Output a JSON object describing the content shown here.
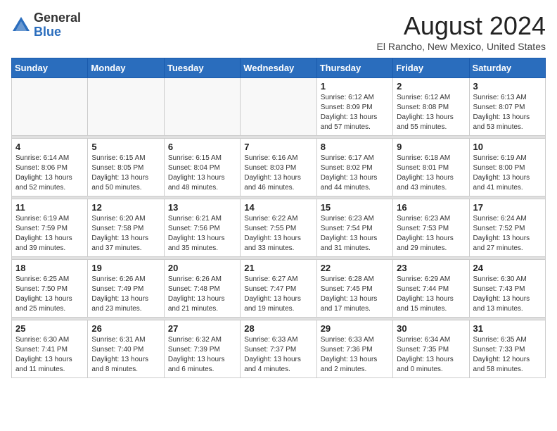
{
  "header": {
    "logo_general": "General",
    "logo_blue": "Blue",
    "month_year": "August 2024",
    "location": "El Rancho, New Mexico, United States"
  },
  "weekdays": [
    "Sunday",
    "Monday",
    "Tuesday",
    "Wednesday",
    "Thursday",
    "Friday",
    "Saturday"
  ],
  "weeks": [
    [
      {
        "day": "",
        "sunrise": "",
        "sunset": "",
        "daylight": ""
      },
      {
        "day": "",
        "sunrise": "",
        "sunset": "",
        "daylight": ""
      },
      {
        "day": "",
        "sunrise": "",
        "sunset": "",
        "daylight": ""
      },
      {
        "day": "",
        "sunrise": "",
        "sunset": "",
        "daylight": ""
      },
      {
        "day": "1",
        "sunrise": "Sunrise: 6:12 AM",
        "sunset": "Sunset: 8:09 PM",
        "daylight": "Daylight: 13 hours and 57 minutes."
      },
      {
        "day": "2",
        "sunrise": "Sunrise: 6:12 AM",
        "sunset": "Sunset: 8:08 PM",
        "daylight": "Daylight: 13 hours and 55 minutes."
      },
      {
        "day": "3",
        "sunrise": "Sunrise: 6:13 AM",
        "sunset": "Sunset: 8:07 PM",
        "daylight": "Daylight: 13 hours and 53 minutes."
      }
    ],
    [
      {
        "day": "4",
        "sunrise": "Sunrise: 6:14 AM",
        "sunset": "Sunset: 8:06 PM",
        "daylight": "Daylight: 13 hours and 52 minutes."
      },
      {
        "day": "5",
        "sunrise": "Sunrise: 6:15 AM",
        "sunset": "Sunset: 8:05 PM",
        "daylight": "Daylight: 13 hours and 50 minutes."
      },
      {
        "day": "6",
        "sunrise": "Sunrise: 6:15 AM",
        "sunset": "Sunset: 8:04 PM",
        "daylight": "Daylight: 13 hours and 48 minutes."
      },
      {
        "day": "7",
        "sunrise": "Sunrise: 6:16 AM",
        "sunset": "Sunset: 8:03 PM",
        "daylight": "Daylight: 13 hours and 46 minutes."
      },
      {
        "day": "8",
        "sunrise": "Sunrise: 6:17 AM",
        "sunset": "Sunset: 8:02 PM",
        "daylight": "Daylight: 13 hours and 44 minutes."
      },
      {
        "day": "9",
        "sunrise": "Sunrise: 6:18 AM",
        "sunset": "Sunset: 8:01 PM",
        "daylight": "Daylight: 13 hours and 43 minutes."
      },
      {
        "day": "10",
        "sunrise": "Sunrise: 6:19 AM",
        "sunset": "Sunset: 8:00 PM",
        "daylight": "Daylight: 13 hours and 41 minutes."
      }
    ],
    [
      {
        "day": "11",
        "sunrise": "Sunrise: 6:19 AM",
        "sunset": "Sunset: 7:59 PM",
        "daylight": "Daylight: 13 hours and 39 minutes."
      },
      {
        "day": "12",
        "sunrise": "Sunrise: 6:20 AM",
        "sunset": "Sunset: 7:58 PM",
        "daylight": "Daylight: 13 hours and 37 minutes."
      },
      {
        "day": "13",
        "sunrise": "Sunrise: 6:21 AM",
        "sunset": "Sunset: 7:56 PM",
        "daylight": "Daylight: 13 hours and 35 minutes."
      },
      {
        "day": "14",
        "sunrise": "Sunrise: 6:22 AM",
        "sunset": "Sunset: 7:55 PM",
        "daylight": "Daylight: 13 hours and 33 minutes."
      },
      {
        "day": "15",
        "sunrise": "Sunrise: 6:23 AM",
        "sunset": "Sunset: 7:54 PM",
        "daylight": "Daylight: 13 hours and 31 minutes."
      },
      {
        "day": "16",
        "sunrise": "Sunrise: 6:23 AM",
        "sunset": "Sunset: 7:53 PM",
        "daylight": "Daylight: 13 hours and 29 minutes."
      },
      {
        "day": "17",
        "sunrise": "Sunrise: 6:24 AM",
        "sunset": "Sunset: 7:52 PM",
        "daylight": "Daylight: 13 hours and 27 minutes."
      }
    ],
    [
      {
        "day": "18",
        "sunrise": "Sunrise: 6:25 AM",
        "sunset": "Sunset: 7:50 PM",
        "daylight": "Daylight: 13 hours and 25 minutes."
      },
      {
        "day": "19",
        "sunrise": "Sunrise: 6:26 AM",
        "sunset": "Sunset: 7:49 PM",
        "daylight": "Daylight: 13 hours and 23 minutes."
      },
      {
        "day": "20",
        "sunrise": "Sunrise: 6:26 AM",
        "sunset": "Sunset: 7:48 PM",
        "daylight": "Daylight: 13 hours and 21 minutes."
      },
      {
        "day": "21",
        "sunrise": "Sunrise: 6:27 AM",
        "sunset": "Sunset: 7:47 PM",
        "daylight": "Daylight: 13 hours and 19 minutes."
      },
      {
        "day": "22",
        "sunrise": "Sunrise: 6:28 AM",
        "sunset": "Sunset: 7:45 PM",
        "daylight": "Daylight: 13 hours and 17 minutes."
      },
      {
        "day": "23",
        "sunrise": "Sunrise: 6:29 AM",
        "sunset": "Sunset: 7:44 PM",
        "daylight": "Daylight: 13 hours and 15 minutes."
      },
      {
        "day": "24",
        "sunrise": "Sunrise: 6:30 AM",
        "sunset": "Sunset: 7:43 PM",
        "daylight": "Daylight: 13 hours and 13 minutes."
      }
    ],
    [
      {
        "day": "25",
        "sunrise": "Sunrise: 6:30 AM",
        "sunset": "Sunset: 7:41 PM",
        "daylight": "Daylight: 13 hours and 11 minutes."
      },
      {
        "day": "26",
        "sunrise": "Sunrise: 6:31 AM",
        "sunset": "Sunset: 7:40 PM",
        "daylight": "Daylight: 13 hours and 8 minutes."
      },
      {
        "day": "27",
        "sunrise": "Sunrise: 6:32 AM",
        "sunset": "Sunset: 7:39 PM",
        "daylight": "Daylight: 13 hours and 6 minutes."
      },
      {
        "day": "28",
        "sunrise": "Sunrise: 6:33 AM",
        "sunset": "Sunset: 7:37 PM",
        "daylight": "Daylight: 13 hours and 4 minutes."
      },
      {
        "day": "29",
        "sunrise": "Sunrise: 6:33 AM",
        "sunset": "Sunset: 7:36 PM",
        "daylight": "Daylight: 13 hours and 2 minutes."
      },
      {
        "day": "30",
        "sunrise": "Sunrise: 6:34 AM",
        "sunset": "Sunset: 7:35 PM",
        "daylight": "Daylight: 13 hours and 0 minutes."
      },
      {
        "day": "31",
        "sunrise": "Sunrise: 6:35 AM",
        "sunset": "Sunset: 7:33 PM",
        "daylight": "Daylight: 12 hours and 58 minutes."
      }
    ]
  ]
}
